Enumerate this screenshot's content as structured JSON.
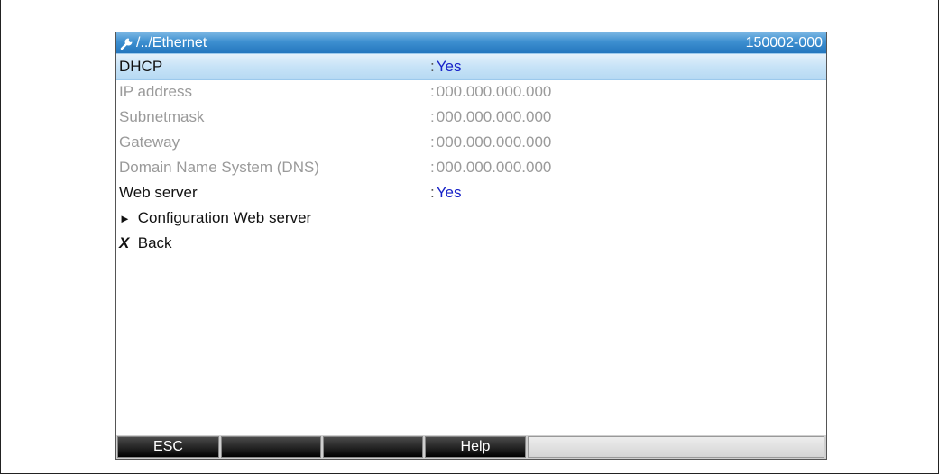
{
  "titlebar": {
    "path": "/../Ethernet",
    "code": "150002-000"
  },
  "rows": [
    {
      "label": "DHCP",
      "value": "Yes"
    },
    {
      "label": "IP address",
      "value": "000.000.000.000"
    },
    {
      "label": "Subnetmask",
      "value": "000.000.000.000"
    },
    {
      "label": "Gateway",
      "value": "000.000.000.000"
    },
    {
      "label": "Domain Name System (DNS)",
      "value": "000.000.000.000"
    },
    {
      "label": "Web server",
      "value": "Yes"
    },
    {
      "label": "Configuration Web server",
      "icon": "►"
    },
    {
      "label": "Back",
      "icon": "X"
    }
  ],
  "colon": ":",
  "softkeys": [
    "ESC",
    "",
    "",
    "Help"
  ],
  "colors": {
    "titlebar": "#2476be",
    "value_active": "#1722c8",
    "disabled_text": "#9a9a9a",
    "selected_row": "#c7e3f7"
  },
  "icons": {
    "titlebar": "wrench-icon",
    "submenu": "play-arrow-icon",
    "back": "x-back-icon"
  }
}
